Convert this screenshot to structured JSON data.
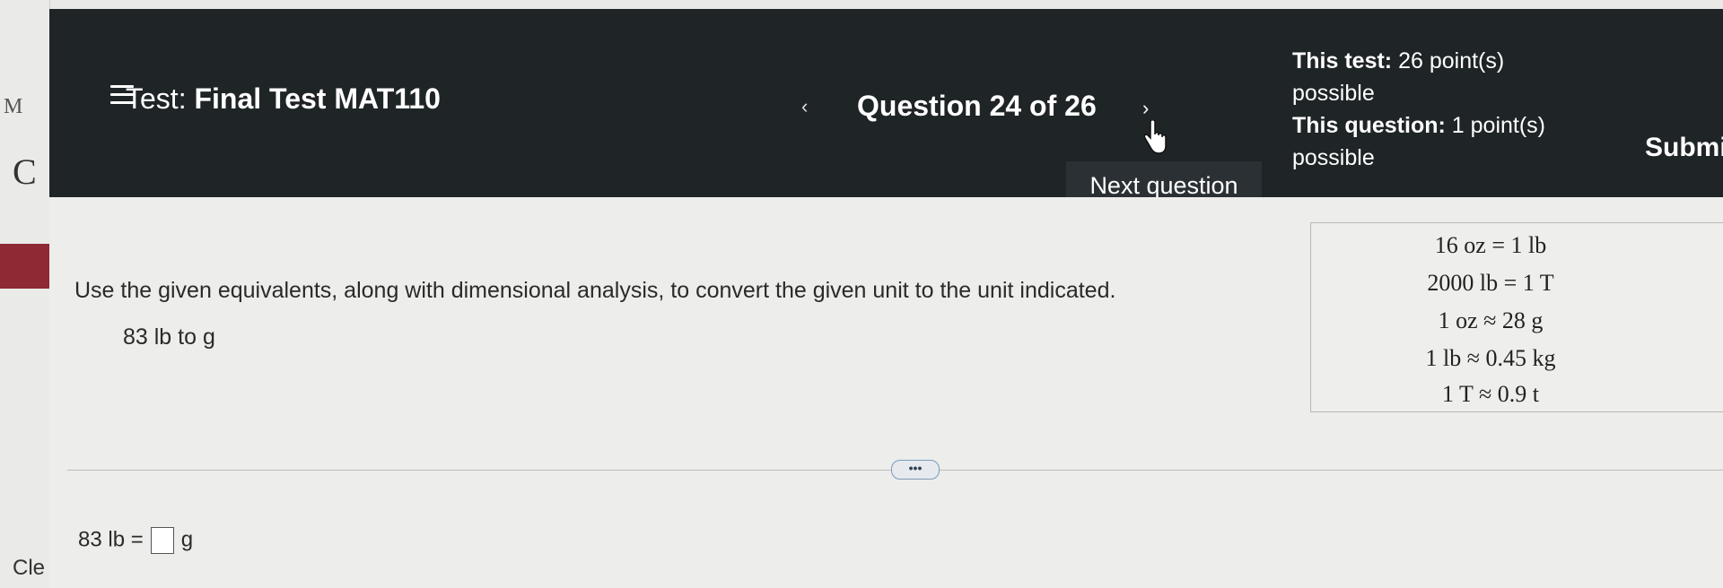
{
  "side_page": {
    "letter_top": "M",
    "letter_mid": "C",
    "bottom_text": "Cle"
  },
  "header": {
    "test_label": "Test:",
    "test_name": "Final Test MAT110",
    "question_counter": "Question 24 of 26",
    "prev_glyph": "‹",
    "next_glyph": "›",
    "this_test_label": "This test:",
    "this_test_value": "26 point(s) possible",
    "this_question_label": "This question:",
    "this_question_value": "1 point(s) possible",
    "submit_label": "Submit te"
  },
  "tooltip": {
    "text": "Next question"
  },
  "question": {
    "instructions": "Use the given equivalents, along with dimensional analysis, to convert the given unit to the unit indicated.",
    "problem": "83 lb to g",
    "answer_prefix": "83 lb =",
    "answer_unit": "g",
    "more_label": "•••"
  },
  "equivalents": [
    "16 oz = 1 lb",
    "2000 lb = 1 T",
    "1 oz ≈ 28 g",
    "1 lb ≈ 0.45 kg",
    "1 T ≈ 0.9 t"
  ],
  "colors": {
    "header_bg": "#1f2427",
    "side_accent": "#8e2a33"
  }
}
